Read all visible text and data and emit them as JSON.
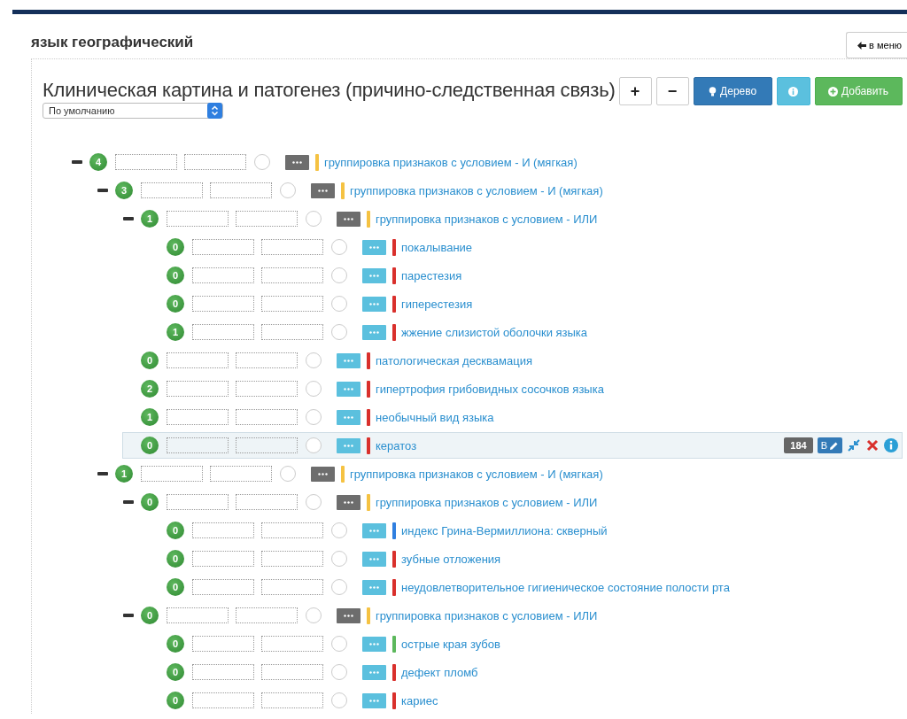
{
  "page_title": "язык географический",
  "menu_button": "в меню",
  "panel": {
    "title": "Клиническая картина и патогенез (причино-следственная связь)",
    "toolbar": [
      {
        "kind": "plus",
        "label": "+"
      },
      {
        "kind": "minus",
        "label": "−"
      },
      {
        "kind": "tree",
        "label": "Дерево"
      },
      {
        "kind": "info"
      },
      {
        "kind": "add",
        "label": "Добавить"
      }
    ],
    "select": "По умолчанию"
  },
  "tree": [
    {
      "kind": "group",
      "count": "4",
      "expanded": true,
      "selected": false,
      "color": "#f5c242",
      "label": "группировка признаков с условием - И (мягкая)",
      "children": [
        {
          "kind": "group",
          "count": "3",
          "expanded": true,
          "selected": false,
          "color": "#f5c242",
          "label": "группировка признаков с условием - И (мягкая)",
          "children": [
            {
              "kind": "group",
              "count": "1",
              "expanded": true,
              "selected": false,
              "color": "#f5c242",
              "label": "группировка признаков с условием - ИЛИ",
              "children": [
                {
                  "kind": "item",
                  "count": "0",
                  "selected": false,
                  "color": "#d9302c",
                  "label": "покалывание"
                },
                {
                  "kind": "item",
                  "count": "0",
                  "selected": false,
                  "color": "#d9302c",
                  "label": "парестезия"
                },
                {
                  "kind": "item",
                  "count": "0",
                  "selected": false,
                  "color": "#d9302c",
                  "label": "гиперестезия"
                },
                {
                  "kind": "item",
                  "count": "1",
                  "selected": false,
                  "color": "#d9302c",
                  "label": "жжение слизистой оболочки языка"
                }
              ]
            },
            {
              "kind": "item",
              "count": "0",
              "selected": false,
              "color": "#d9302c",
              "label": "патологическая десквамация"
            },
            {
              "kind": "item",
              "count": "2",
              "selected": false,
              "color": "#d9302c",
              "label": "гипертрофия грибовидных сосочков языка"
            },
            {
              "kind": "item",
              "count": "1",
              "selected": false,
              "color": "#d9302c",
              "label": "необычный вид языка"
            },
            {
              "kind": "item",
              "count": "0",
              "selected": true,
              "color": "#d9302c",
              "label": "кератоз",
              "actions": {
                "count": "184",
                "edit_label": "B"
              }
            }
          ]
        },
        {
          "kind": "group",
          "count": "1",
          "expanded": true,
          "selected": false,
          "color": "#f5c242",
          "label": "группировка признаков с условием - И (мягкая)",
          "children": [
            {
              "kind": "group",
              "count": "0",
              "expanded": true,
              "selected": false,
              "color": "#f5c242",
              "label": "группировка признаков с условием - ИЛИ",
              "children": [
                {
                  "kind": "item",
                  "count": "0",
                  "selected": false,
                  "color": "#2f7fe0",
                  "label": "индекс Грина-Вермиллиона: скверный"
                },
                {
                  "kind": "item",
                  "count": "0",
                  "selected": false,
                  "color": "#d9302c",
                  "label": "зубные отложения"
                },
                {
                  "kind": "item",
                  "count": "0",
                  "selected": false,
                  "color": "#d9302c",
                  "label": "неудовлетворительное гигиеническое состояние полости рта"
                }
              ]
            },
            {
              "kind": "group",
              "count": "0",
              "expanded": true,
              "selected": false,
              "color": "#f5c242",
              "label": "группировка признаков с условием - ИЛИ",
              "children": [
                {
                  "kind": "item",
                  "count": "0",
                  "selected": false,
                  "color": "#5cb85c",
                  "label": "острые края зубов"
                },
                {
                  "kind": "item",
                  "count": "0",
                  "selected": false,
                  "color": "#d9302c",
                  "label": "дефект пломб"
                },
                {
                  "kind": "item",
                  "count": "0",
                  "selected": false,
                  "color": "#d9302c",
                  "label": "кариес"
                }
              ]
            }
          ]
        }
      ]
    }
  ]
}
